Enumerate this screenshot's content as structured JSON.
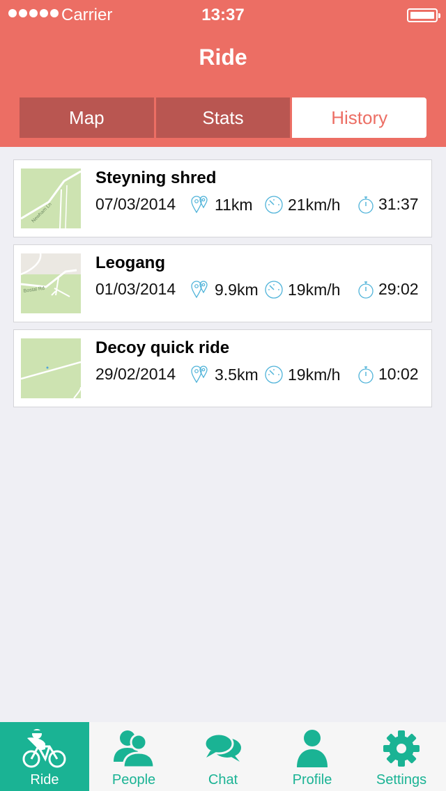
{
  "status_bar": {
    "carrier": "Carrier",
    "time": "13:37"
  },
  "header": {
    "title": "Ride"
  },
  "segments": [
    {
      "label": "Map",
      "active": false
    },
    {
      "label": "Stats",
      "active": false
    },
    {
      "label": "History",
      "active": true
    }
  ],
  "rides": [
    {
      "name": "Steyning shred",
      "date": "07/03/2014",
      "distance": "11km",
      "speed": "21km/h",
      "duration": "31:37",
      "map_label": "Newham Ln"
    },
    {
      "name": "Leogang",
      "date": "01/03/2014",
      "distance": "9.9km",
      "speed": "19km/h",
      "duration": "29:02",
      "map_label": "Bostal Rd"
    },
    {
      "name": "Decoy quick ride",
      "date": "29/02/2014",
      "distance": "3.5km",
      "speed": "19km/h",
      "duration": "10:02",
      "map_label": ""
    }
  ],
  "tabs": [
    {
      "label": "Ride",
      "icon": "bicycle-icon",
      "active": true
    },
    {
      "label": "People",
      "icon": "people-icon",
      "active": false
    },
    {
      "label": "Chat",
      "icon": "chat-icon",
      "active": false
    },
    {
      "label": "Profile",
      "icon": "profile-icon",
      "active": false
    },
    {
      "label": "Settings",
      "icon": "gear-icon",
      "active": false
    }
  ],
  "colors": {
    "header": "#ec6e64",
    "segment_inactive": "#b95651",
    "tab_accent": "#1ab394",
    "icon_blue": "#4fb3d9",
    "map_green": "#cde3b1"
  }
}
